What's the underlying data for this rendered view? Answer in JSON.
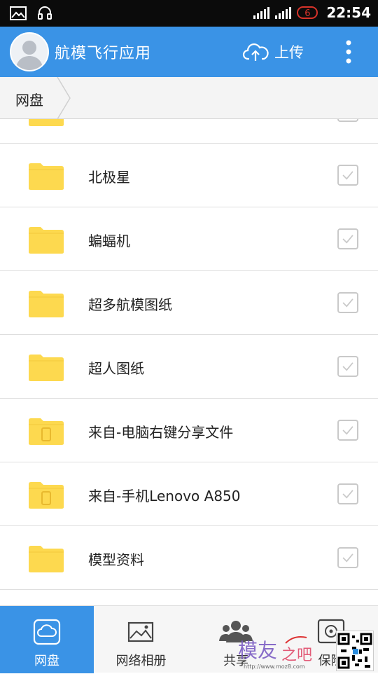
{
  "status_bar": {
    "time": "22:54",
    "notification_count": "6",
    "icons": [
      "image-notification-icon",
      "headset-icon",
      "signal-icon",
      "signal-icon",
      "battery-icon"
    ]
  },
  "app_bar": {
    "title": "航模飞行应用",
    "upload_label": "上传",
    "icons": [
      "avatar",
      "cloud-upload-icon",
      "more-vert-icon"
    ]
  },
  "breadcrumb": {
    "root": "网盘"
  },
  "files": [
    {
      "name": "北极星",
      "type": "folder"
    },
    {
      "name": "蝙蝠机",
      "type": "folder"
    },
    {
      "name": "超多航模图纸",
      "type": "folder"
    },
    {
      "name": "超人图纸",
      "type": "folder"
    },
    {
      "name": "来自-电脑右键分享文件",
      "type": "folder-with-device"
    },
    {
      "name": "来自-手机Lenovo A850",
      "type": "folder-with-device"
    },
    {
      "name": "模型资料",
      "type": "folder"
    }
  ],
  "bottom_nav": {
    "tabs": [
      {
        "label": "网盘",
        "icon": "cloud-drive-icon",
        "active": true
      },
      {
        "label": "网络相册",
        "icon": "photo-album-icon",
        "active": false
      },
      {
        "label": "共享",
        "icon": "share-people-icon",
        "active": false
      },
      {
        "label": "保险",
        "icon": "safe-icon",
        "active": false
      }
    ]
  },
  "watermark": {
    "text": "模友之吧",
    "url": "http://www.moz8.com"
  },
  "colors": {
    "primary": "#3a93e6",
    "folder": "#fdd94f",
    "status_badge": "#d8332a"
  }
}
